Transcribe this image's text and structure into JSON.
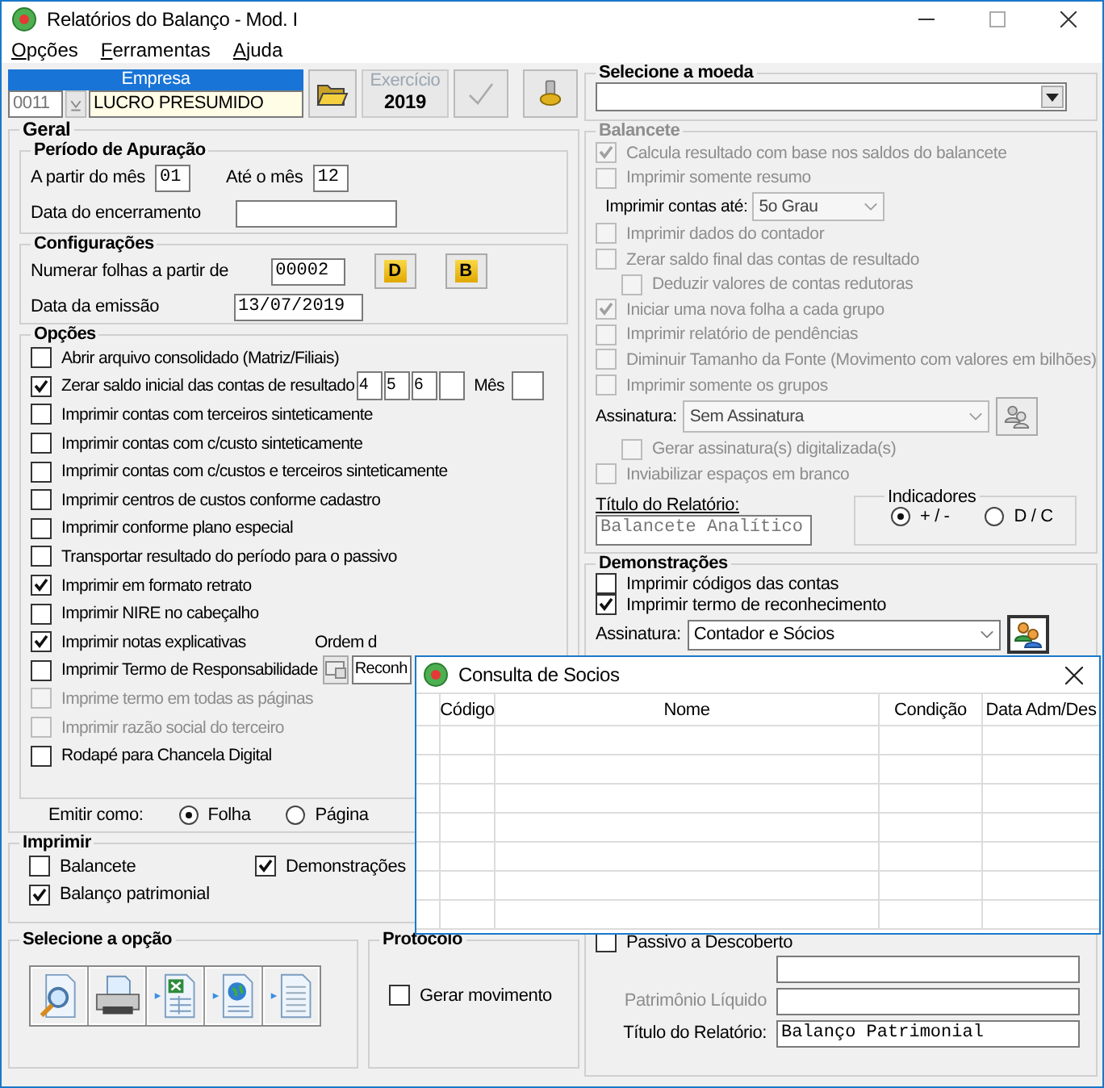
{
  "window": {
    "title": "Relatórios do Balanço - Mod. I"
  },
  "menu": [
    "Opções",
    "Ferramentas",
    "Ajuda"
  ],
  "empresa": {
    "label": "Empresa",
    "code": "0011",
    "name": "LUCRO PRESUMIDO"
  },
  "exercicio": {
    "label": "Exercício",
    "value": "2019"
  },
  "geral": {
    "title": "Geral",
    "periodo": {
      "title": "Período de Apuração",
      "from_label": "A partir do mês",
      "from": "01",
      "to_label": "Até o mês",
      "to": "12",
      "closing_label": "Data do encerramento"
    },
    "config": {
      "title": "Configurações",
      "numbering_label": "Numerar folhas a partir de",
      "numbering": "00002",
      "buttons": [
        "D",
        "B"
      ],
      "date_label": "Data da emissão",
      "date": "13/07/2019"
    },
    "options": {
      "title": "Opções",
      "items": [
        {
          "kind": "check",
          "label": "Abrir arquivo consolidado (Matriz/Filiais)",
          "checked": false,
          "disabled": false
        },
        {
          "kind": "months",
          "label": "Zerar saldo inicial das contas de resultado",
          "checked": true,
          "disabled": false,
          "months": [
            "4",
            "5",
            "6"
          ],
          "month_label": "Mês"
        },
        {
          "kind": "check",
          "label": "Imprimir contas com terceiros sinteticamente",
          "checked": false,
          "disabled": false
        },
        {
          "kind": "check",
          "label": "Imprimir contas com c/custo sinteticamente",
          "checked": false,
          "disabled": false
        },
        {
          "kind": "check",
          "label": "Imprimir contas com c/custos e terceiros sinteticamente",
          "checked": false,
          "disabled": false
        },
        {
          "kind": "check",
          "label": "Imprimir centros de custos conforme cadastro",
          "checked": false,
          "disabled": false
        },
        {
          "kind": "check",
          "label": "Imprimir conforme plano especial",
          "checked": false,
          "disabled": false
        },
        {
          "kind": "check",
          "label": "Transportar resultado do período para o passivo",
          "checked": false,
          "disabled": false
        },
        {
          "kind": "check",
          "label": "Imprimir em formato retrato",
          "checked": true,
          "disabled": false
        },
        {
          "kind": "check",
          "label": "Imprimir NIRE no cabeçalho",
          "checked": false,
          "disabled": false
        },
        {
          "kind": "order",
          "label": "Imprimir notas explicativas",
          "checked": true,
          "disabled": false,
          "side_label": "Ordem d"
        },
        {
          "kind": "term",
          "label": "Imprimir Termo de Responsabilidade",
          "checked": false,
          "disabled": false,
          "field": "Reconh"
        },
        {
          "kind": "check",
          "label": "Imprime termo em todas as páginas",
          "checked": false,
          "disabled": true
        },
        {
          "kind": "check",
          "label": "Imprimir razão social do terceiro",
          "checked": false,
          "disabled": true
        },
        {
          "kind": "check",
          "label": "Rodapé para Chancela Digital",
          "checked": false,
          "disabled": false
        }
      ]
    },
    "emit": {
      "label": "Emitir como:",
      "choices": [
        {
          "label": "Folha",
          "selected": true
        },
        {
          "label": "Página",
          "selected": false
        }
      ]
    }
  },
  "imprimir": {
    "title": "Imprimir",
    "items": [
      {
        "label": "Balancete",
        "checked": false
      },
      {
        "label": "Demonstrações",
        "checked": true
      },
      {
        "label": "Balanço patrimonial",
        "checked": true
      }
    ]
  },
  "selecione_opcao": {
    "title": "Selecione a opção"
  },
  "protocolo": {
    "title": "Protocolo",
    "items": [
      {
        "label": "Gerar movimento",
        "checked": false
      }
    ]
  },
  "moeda": {
    "title": "Selecione a moeda"
  },
  "balancete": {
    "title": "Balancete",
    "disabled": true,
    "items": [
      {
        "kind": "check",
        "label": "Calcula resultado com base nos saldos do balancete",
        "checked": true,
        "disabled": true
      },
      {
        "kind": "check",
        "label": "Imprimir somente resumo",
        "checked": false,
        "disabled": true
      },
      {
        "kind": "select",
        "label": "Imprimir contas até:",
        "value": "5o Grau",
        "disabled": true
      },
      {
        "kind": "check",
        "label": "Imprimir dados do contador",
        "checked": false,
        "disabled": true
      },
      {
        "kind": "check",
        "label": "Zerar saldo final das contas de resultado",
        "checked": false,
        "disabled": true
      },
      {
        "kind": "subcheck",
        "label": "Deduzir valores de contas redutoras",
        "checked": false,
        "disabled": true
      },
      {
        "kind": "check",
        "label": "Iniciar uma nova folha a cada grupo",
        "checked": true,
        "disabled": true
      },
      {
        "kind": "check",
        "label": "Imprimir relatório de pendências",
        "checked": false,
        "disabled": true
      },
      {
        "kind": "check",
        "label": "Diminuir Tamanho da Fonte (Movimento com valores em bilhões)",
        "checked": false,
        "disabled": true
      },
      {
        "kind": "check",
        "label": "Imprimir somente os grupos",
        "checked": false,
        "disabled": true
      },
      {
        "kind": "signature",
        "label": "Assinatura:",
        "value": "Sem Assinatura",
        "disabled": true
      },
      {
        "kind": "subcheck",
        "label": "Gerar assinatura(s) digitalizada(s)",
        "checked": false,
        "disabled": true
      },
      {
        "kind": "check",
        "label": "Inviabilizar espaços em branco",
        "checked": false,
        "disabled": true
      }
    ],
    "report_title_label": "Título do Relatório:",
    "report_title": "Balancete Analítico",
    "indicators": {
      "title": "Indicadores",
      "choices": [
        {
          "label": "+ / -",
          "selected": true
        },
        {
          "label": "D / C",
          "selected": false
        }
      ]
    }
  },
  "demonstracoes": {
    "title": "Demonstrações",
    "items": [
      {
        "label": "Imprimir códigos das contas",
        "checked": false
      },
      {
        "label": "Imprimir termo de reconhecimento",
        "checked": true
      }
    ],
    "signature_label": "Assinatura:",
    "signature": "Contador e Sócios",
    "passivo": {
      "label": "Passivo a Descoberto",
      "checked": false
    },
    "pl_label": "Patrimônio Líquido",
    "title_label": "Título do Relatório:",
    "report_title": "Balanço Patrimonial"
  },
  "popup": {
    "title": "Consulta de Socios",
    "columns": [
      "Código",
      "Nome",
      "Condição",
      "Data Adm/Des"
    ]
  }
}
